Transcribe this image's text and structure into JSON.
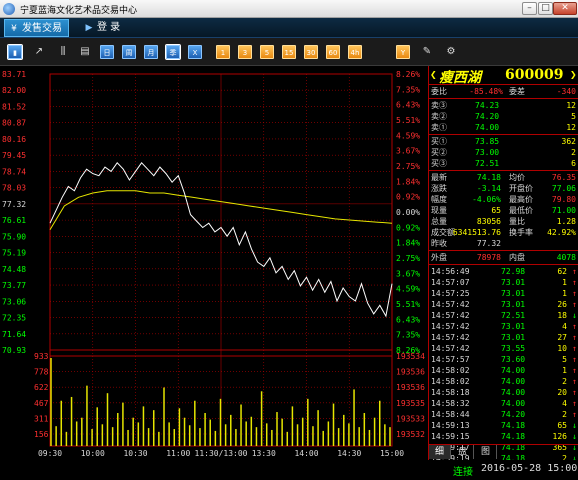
{
  "window": {
    "title": "宁夏蓝海文化艺术品交易中心",
    "min": "–",
    "max": "□",
    "close": "✕"
  },
  "menu": [
    {
      "label": "发售交易",
      "icon": "yen-icon",
      "glyph": "¥",
      "active": true
    },
    {
      "label": "登  录",
      "icon": "login-icon",
      "glyph": "▶",
      "active": false
    }
  ],
  "toolbar": [
    {
      "name": "bar-chart-tool",
      "text": "▮",
      "style": "blue",
      "selected": true
    },
    {
      "name": "line-chart-tool",
      "text": "↗",
      "style": "plain"
    },
    {
      "name": "candle-chart-tool",
      "text": "⫼",
      "style": "plain"
    },
    {
      "name": "calendar-tool",
      "text": "▤",
      "style": "plain"
    },
    {
      "name": "period-day-button",
      "text": "日",
      "style": "blue"
    },
    {
      "name": "period-week-button",
      "text": "周",
      "style": "blue"
    },
    {
      "name": "period-month-button",
      "text": "月",
      "style": "blue"
    },
    {
      "name": "period-season-button",
      "text": "季",
      "style": "blue",
      "selected": true
    },
    {
      "name": "period-x-button",
      "text": "X",
      "style": "blue"
    },
    {
      "name": "minute-1-button",
      "text": "1",
      "style": "orange"
    },
    {
      "name": "minute-3-button",
      "text": "3",
      "style": "orange"
    },
    {
      "name": "minute-5-button",
      "text": "5",
      "style": "orange"
    },
    {
      "name": "minute-15-button",
      "text": "15",
      "style": "orange"
    },
    {
      "name": "minute-30-button",
      "text": "30",
      "style": "orange"
    },
    {
      "name": "minute-60-button",
      "text": "60",
      "style": "orange"
    },
    {
      "name": "minute-240-button",
      "text": "4h",
      "style": "orange"
    },
    {
      "name": "year-button",
      "text": "Y",
      "style": "orange"
    },
    {
      "name": "draw-tool-button",
      "text": "✎",
      "style": "plain"
    },
    {
      "name": "settings-button",
      "text": "⚙",
      "style": "plain"
    }
  ],
  "chart_data": {
    "type": "line",
    "price_axis_left": [
      "83.71",
      "82.00",
      "81.52",
      "80.87",
      "80.16",
      "79.45",
      "78.74",
      "78.03",
      "77.32",
      "76.61",
      "75.90",
      "75.19",
      "74.48",
      "73.77",
      "73.06",
      "72.35",
      "71.64",
      "70.93"
    ],
    "pct_axis_right": [
      "8.26%",
      "7.35%",
      "6.43%",
      "5.51%",
      "4.59%",
      "3.67%",
      "2.75%",
      "1.84%",
      "0.92%",
      "0.00%",
      "0.92%",
      "1.84%",
      "2.75%",
      "3.67%",
      "4.59%",
      "5.51%",
      "6.43%",
      "7.35%",
      "8.26%"
    ],
    "pct_axis_right_colors": [
      "r",
      "r",
      "r",
      "r",
      "r",
      "r",
      "r",
      "r",
      "r",
      "w",
      "g",
      "g",
      "g",
      "g",
      "g",
      "g",
      "g",
      "g",
      "g"
    ],
    "volume_axis_left": [
      "933",
      "778",
      "622",
      "467",
      "311",
      "156"
    ],
    "volume_axis_right": [
      "193534",
      "193536",
      "193536",
      "193535",
      "193533",
      "193532"
    ],
    "time_axis": [
      "09:30",
      "10:00",
      "10:30",
      "11:00",
      "11:30/13:00",
      "13:30",
      "14:00",
      "14:30",
      "15:00"
    ],
    "prev_close": 77.32,
    "price_max": 83.71,
    "price_min": 70.93,
    "volume_max": 933,
    "price_series": [
      76.8,
      77.4,
      78.0,
      78.5,
      78.3,
      78.9,
      79.3,
      79.1,
      79.0,
      79.4,
      79.2,
      79.6,
      79.3,
      78.8,
      79.2,
      79.6,
      79.3,
      79.0,
      79.4,
      79.1,
      78.7,
      79.0,
      78.2,
      77.2,
      76.9,
      76.6,
      76.8,
      76.4,
      76.6,
      76.2,
      76.6,
      75.8,
      76.4,
      75.6,
      75.0,
      74.8,
      75.2,
      74.5,
      74.8,
      74.2,
      74.6,
      73.9,
      74.3,
      73.7,
      74.2,
      73.6,
      74.1,
      73.2,
      73.8,
      73.4,
      73.2,
      74.0,
      73.1,
      72.6,
      73.0,
      72.5,
      74.0
    ],
    "avg_series": [
      76.5,
      77.6,
      78.0,
      78.2,
      78.3,
      78.3,
      78.3,
      78.2,
      78.2,
      78.1,
      78.0,
      77.9,
      77.8,
      77.7,
      77.6,
      77.5,
      77.4,
      77.3,
      77.2,
      77.1,
      77.0,
      76.95,
      76.9,
      76.85,
      76.8
    ],
    "volume_series": [
      933,
      210,
      480,
      150,
      520,
      260,
      300,
      640,
      180,
      410,
      230,
      560,
      200,
      350,
      460,
      170,
      300,
      250,
      420,
      190,
      380,
      150,
      620,
      250,
      180,
      400,
      300,
      220,
      480,
      190,
      350,
      280,
      160,
      500,
      230,
      330,
      180,
      440,
      260,
      310,
      200,
      580,
      240,
      170,
      360,
      290,
      150,
      420,
      230,
      300,
      500,
      210,
      380,
      160,
      260,
      450,
      190,
      330,
      240,
      600,
      200,
      350,
      170,
      300,
      480,
      230,
      200
    ]
  },
  "quote": {
    "name": "瘦西湖",
    "code": "600009",
    "weibi": {
      "label": "委比",
      "value": "-85.48%",
      "label2": "委差",
      "value2": "-340"
    },
    "sell": [
      {
        "label": "卖③",
        "price": "74.23",
        "vol": "12"
      },
      {
        "label": "卖②",
        "price": "74.20",
        "vol": "5"
      },
      {
        "label": "卖①",
        "price": "74.00",
        "vol": "12"
      }
    ],
    "buy": [
      {
        "label": "买①",
        "price": "73.85",
        "vol": "362"
      },
      {
        "label": "买②",
        "price": "73.00",
        "vol": "2"
      },
      {
        "label": "买③",
        "price": "72.51",
        "vol": "6"
      }
    ],
    "stats": [
      {
        "l1": "最新",
        "v1": "74.18",
        "c1": "g",
        "l2": "均价",
        "v2": "76.35",
        "c2": "r"
      },
      {
        "l1": "涨跌",
        "v1": "-3.14",
        "c1": "g",
        "l2": "开盘价",
        "v2": "77.06",
        "c2": "g"
      },
      {
        "l1": "幅度",
        "v1": "-4.06%",
        "c1": "g",
        "l2": "最高价",
        "v2": "79.80",
        "c2": "r"
      },
      {
        "l1": "现量",
        "v1": "65",
        "c1": "y",
        "l2": "最低价",
        "v2": "71.00",
        "c2": "g"
      },
      {
        "l1": "总量",
        "v1": "83056",
        "c1": "y",
        "l2": "量比",
        "v2": "1.28",
        "c2": "y"
      },
      {
        "l1": "成交额",
        "v1": "6341513.76",
        "c1": "y",
        "l2": "换手率",
        "v2": "42.92%",
        "c2": "y"
      },
      {
        "l1": "昨收",
        "v1": "77.32",
        "c1": "w",
        "l2": "",
        "v2": "",
        "c2": "w"
      }
    ],
    "outer_label": "外盘",
    "outer_value": "78978",
    "inner_label": "内盘",
    "inner_value": "4078",
    "trades": [
      {
        "t": "14:56:49",
        "p": "72.98",
        "pc": "g",
        "v": "62",
        "d": "↑"
      },
      {
        "t": "14:57:07",
        "p": "73.01",
        "pc": "g",
        "v": "1",
        "d": "↑"
      },
      {
        "t": "14:57:25",
        "p": "73.01",
        "pc": "g",
        "v": "1",
        "d": "↑"
      },
      {
        "t": "14:57:42",
        "p": "73.01",
        "pc": "g",
        "v": "26",
        "d": "↑"
      },
      {
        "t": "14:57:42",
        "p": "72.51",
        "pc": "g",
        "v": "18",
        "d": "↓"
      },
      {
        "t": "14:57:42",
        "p": "73.01",
        "pc": "g",
        "v": "4",
        "d": "↑"
      },
      {
        "t": "14:57:42",
        "p": "73.01",
        "pc": "g",
        "v": "27",
        "d": "↑"
      },
      {
        "t": "14:57:42",
        "p": "73.55",
        "pc": "g",
        "v": "10",
        "d": "↑"
      },
      {
        "t": "14:57:57",
        "p": "73.60",
        "pc": "g",
        "v": "5",
        "d": "↑"
      },
      {
        "t": "14:58:02",
        "p": "74.00",
        "pc": "g",
        "v": "1",
        "d": "↑"
      },
      {
        "t": "14:58:02",
        "p": "74.00",
        "pc": "g",
        "v": "2",
        "d": "↑"
      },
      {
        "t": "14:58:18",
        "p": "74.00",
        "pc": "g",
        "v": "20",
        "d": "↑"
      },
      {
        "t": "14:58:32",
        "p": "74.00",
        "pc": "g",
        "v": "4",
        "d": "↑"
      },
      {
        "t": "14:58:44",
        "p": "74.20",
        "pc": "g",
        "v": "2",
        "d": "↑"
      },
      {
        "t": "14:59:13",
        "p": "74.18",
        "pc": "g",
        "v": "65",
        "d": "↓"
      },
      {
        "t": "14:59:15",
        "p": "74.18",
        "pc": "g",
        "v": "126",
        "d": "↓"
      },
      {
        "t": "14:59:17",
        "p": "74.18",
        "pc": "g",
        "v": "365",
        "d": "↓"
      },
      {
        "t": "14:59:19",
        "p": "74.18",
        "pc": "g",
        "v": "2",
        "d": "↓"
      },
      {
        "t": "14:59:23",
        "p": "74.18",
        "pc": "g",
        "v": "65",
        "d": "↓"
      }
    ],
    "tabs": [
      "细",
      "盘",
      "图"
    ]
  },
  "status": {
    "connection": "连接",
    "datetime": "2016-05-28 15:00"
  }
}
